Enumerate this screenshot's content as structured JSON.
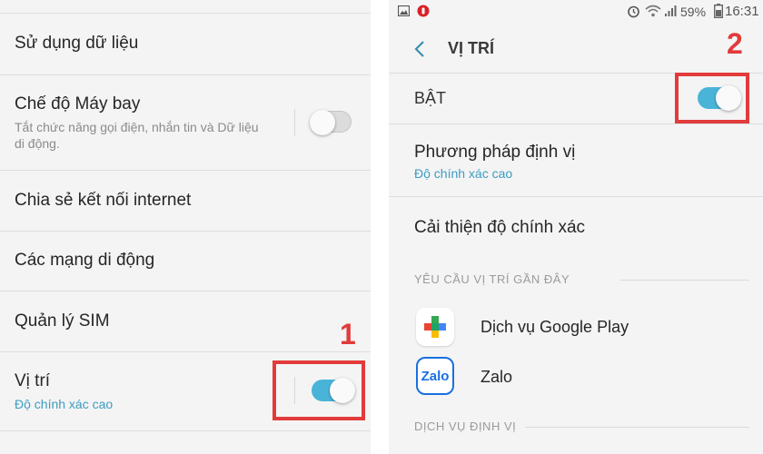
{
  "left_screen": {
    "items": [
      {
        "title": "Sử dụng dữ liệu"
      },
      {
        "title": "Chế độ Máy bay",
        "description": "Tắt chức năng gọi điện, nhắn tin và Dữ liệu di động.",
        "toggle": "off"
      },
      {
        "title": "Chia sẻ kết nối internet"
      },
      {
        "title": "Các mạng di động"
      },
      {
        "title": "Quản lý SIM"
      },
      {
        "title": "Vị trí",
        "subtitle": "Độ chính xác cao",
        "toggle": "on"
      }
    ],
    "marker": "1"
  },
  "right_screen": {
    "status_bar": {
      "battery": "59%",
      "time": "16:31"
    },
    "header": {
      "back_icon": "chevron-left-icon",
      "title": "VỊ TRÍ"
    },
    "master_toggle": {
      "label": "BẬT",
      "state": "on"
    },
    "marker": "2",
    "items": [
      {
        "title": "Phương pháp định vị",
        "subtitle": "Độ chính xác cao"
      },
      {
        "title": "Cải thiện độ chính xác"
      }
    ],
    "sections": {
      "recent": "YÊU CẦU VỊ TRÍ GẦN ĐÂY",
      "services": "DỊCH VỤ ĐỊNH VỊ"
    },
    "recent_apps": [
      {
        "name": "Dịch vụ Google Play",
        "icon": "google-play-services-icon"
      },
      {
        "name": "Zalo",
        "icon": "zalo-icon",
        "icon_text": "Zalo"
      }
    ]
  },
  "colors": {
    "accent": "#4ab4d8",
    "highlight": "#e23b3b",
    "subtitle": "#3d9cc1"
  }
}
